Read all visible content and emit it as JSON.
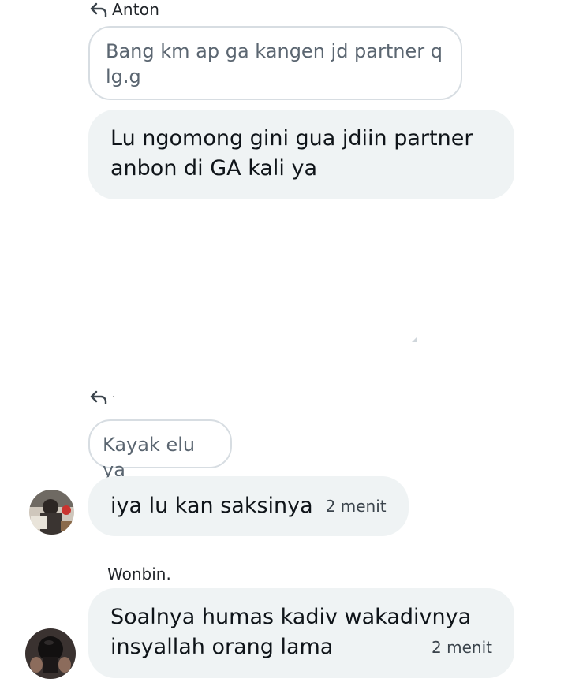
{
  "messages": [
    {
      "reply_to_name": "Anton",
      "quoted_text": "Bang km ap ga kangen jd partner q lg.g",
      "text": "Lu ngomong gini gua jdiin partner anbon di GA kali ya"
    },
    {
      "reply_to_name": "·",
      "quoted_text": "Kayak elu ya",
      "text": "iya lu kan saksinya",
      "time": "2 menit"
    },
    {
      "sender": "Wonbin.",
      "text": "Soalnya humas kadiv wakadivnya insyallah orang lama",
      "time": "2 menit"
    }
  ]
}
